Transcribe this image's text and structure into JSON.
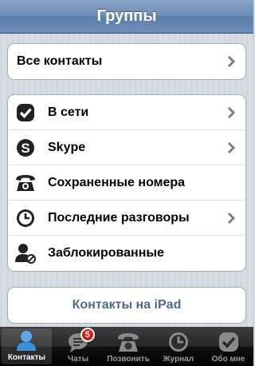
{
  "header": {
    "title": "Группы"
  },
  "all_contacts": {
    "label": "Все контакты"
  },
  "groups": [
    {
      "label": "В сети",
      "icon": "online-check-icon",
      "chevron": true
    },
    {
      "label": "Skype",
      "icon": "skype-icon",
      "chevron": true
    },
    {
      "label": "Сохраненные номера",
      "icon": "phone-icon",
      "chevron": false
    },
    {
      "label": "Последние разговоры",
      "icon": "clock-icon",
      "chevron": true
    },
    {
      "label": "Заблокированные",
      "icon": "blocked-user-icon",
      "chevron": false
    }
  ],
  "ipad_contacts": {
    "label": "Контакты на iPad"
  },
  "tabbar": {
    "tabs": [
      {
        "label": "Контакты",
        "icon": "contacts-icon",
        "active": true
      },
      {
        "label": "Чаты",
        "icon": "chats-icon",
        "badge": "5"
      },
      {
        "label": "Позвонить",
        "icon": "call-icon"
      },
      {
        "label": "Журнал",
        "icon": "history-icon"
      },
      {
        "label": "Обо мне",
        "icon": "profile-check-icon"
      }
    ]
  },
  "colors": {
    "nav": "#6a8bb4",
    "link": "#4f6a8e",
    "badge": "#d51d14"
  }
}
